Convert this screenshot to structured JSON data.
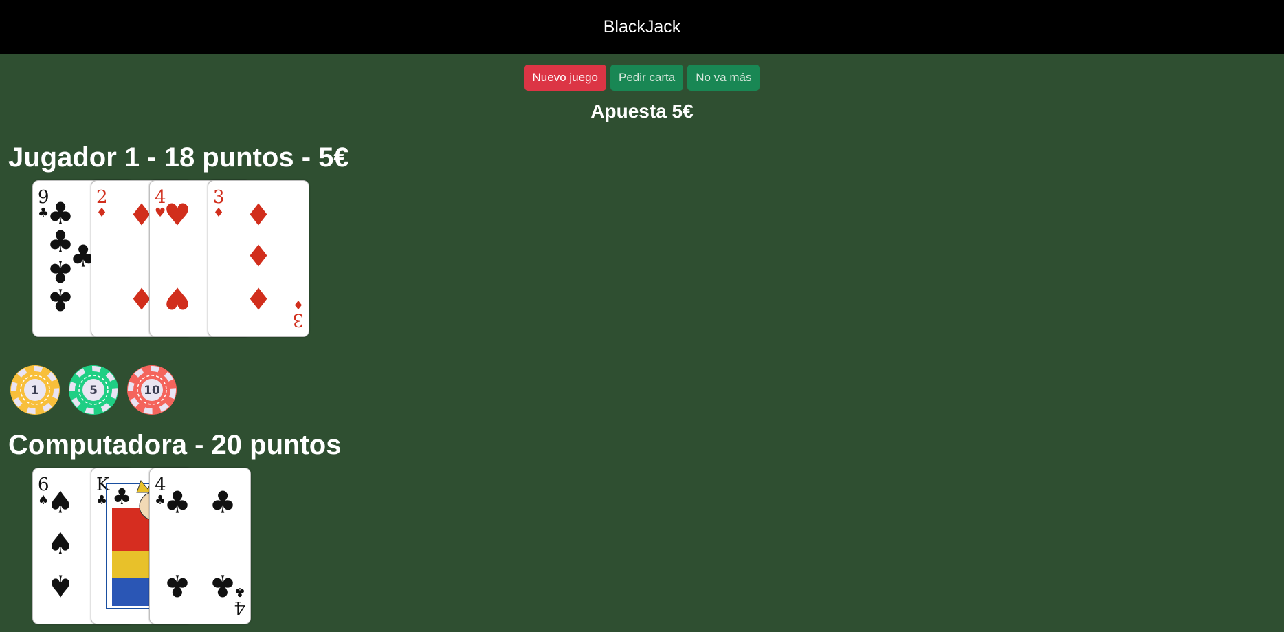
{
  "header": {
    "title": "BlackJack"
  },
  "controls": {
    "new_game": "Nuevo juego",
    "hit": "Pedir carta",
    "stand": "No va más"
  },
  "bet_label": "Apuesta 5€",
  "player": {
    "title": "Jugador 1 - 18 puntos - 5€",
    "cards": [
      {
        "rank": "9",
        "suit": "clubs"
      },
      {
        "rank": "2",
        "suit": "diamonds"
      },
      {
        "rank": "4",
        "suit": "hearts"
      },
      {
        "rank": "3",
        "suit": "diamonds"
      }
    ]
  },
  "chips": [
    {
      "value": "1",
      "color": "#f8bf3b"
    },
    {
      "value": "5",
      "color": "#1fcf84"
    },
    {
      "value": "10",
      "color": "#f4645c"
    }
  ],
  "computer": {
    "title": "Computadora - 20 puntos",
    "cards": [
      {
        "rank": "6",
        "suit": "spades"
      },
      {
        "rank": "K",
        "suit": "clubs"
      },
      {
        "rank": "4",
        "suit": "clubs"
      }
    ]
  },
  "colors": {
    "table": "#2f4f31",
    "header": "#000000",
    "danger": "#dc3545",
    "success": "#198754",
    "card_red": "#d12e1c",
    "card_black": "#111111"
  }
}
